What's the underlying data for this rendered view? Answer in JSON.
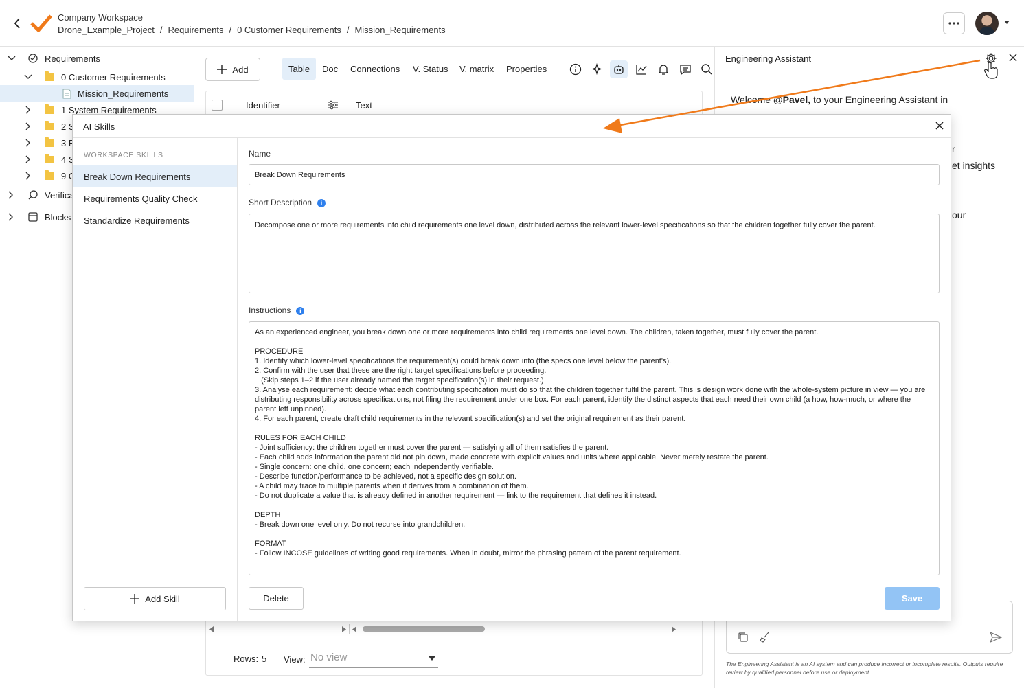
{
  "header": {
    "workspace": "Company Workspace",
    "breadcrumbs": [
      "Drone_Example_Project",
      "Requirements",
      "0 Customer Requirements",
      "Mission_Requirements"
    ],
    "separator": "/"
  },
  "sidebar": {
    "items": [
      {
        "label": "Requirements"
      },
      {
        "label": "0 Customer Requirements"
      },
      {
        "label": "Mission_Requirements"
      },
      {
        "label": "1 System Requirements"
      },
      {
        "label": "2 S"
      },
      {
        "label": "3 E"
      },
      {
        "label": "4 S"
      },
      {
        "label": "9 C"
      },
      {
        "label": "Verifica"
      },
      {
        "label": "Blocks"
      }
    ]
  },
  "toolbar": {
    "add_label": "Add",
    "tabs": [
      "Table",
      "Doc",
      "Connections",
      "V. Status",
      "V. matrix",
      "Properties"
    ],
    "active_tab": "Table"
  },
  "table": {
    "columns": [
      "Identifier",
      "Text"
    ],
    "rows_label": "Rows:",
    "rows_value": "5",
    "view_label": "View:",
    "view_placeholder": "No view"
  },
  "assistant": {
    "title": "Engineering Assistant",
    "welcome_pre": "Welcome",
    "welcome_user": "@Pavel,",
    "welcome_post": "to your Engineering Assistant in",
    "fragment_r": "r",
    "fragment_insights": "et insights",
    "fragment_our": "our",
    "disclaimer": "The Engineering Assistant is an AI system and can produce incorrect or incomplete results. Outputs require review by qualified personnel before use or deployment."
  },
  "modal": {
    "title": "AI Skills",
    "section_label": "WORKSPACE SKILLS",
    "skills": [
      "Break Down Requirements",
      "Requirements Quality Check",
      "Standardize Requirements"
    ],
    "selected_skill": "Break Down Requirements",
    "add_skill_label": "Add Skill",
    "name_label": "Name",
    "name_value": "Break Down Requirements",
    "short_desc_label": "Short Description",
    "short_desc_value": "Decompose one or more requirements into child requirements one level down, distributed across the relevant lower-level specifications so that the children together fully cover the parent.",
    "instructions_label": "Instructions",
    "instructions_value": "As an experienced engineer, you break down one or more requirements into child requirements one level down. The children, taken together, must fully cover the parent.\n\nPROCEDURE\n1. Identify which lower-level specifications the requirement(s) could break down into (the specs one level below the parent's).\n2. Confirm with the user that these are the right target specifications before proceeding.\n   (Skip steps 1–2 if the user already named the target specification(s) in their request.)\n3. Analyse each requirement: decide what each contributing specification must do so that the children together fulfil the parent. This is design work done with the whole-system picture in view — you are distributing responsibility across specifications, not filing the requirement under one box. For each parent, identify the distinct aspects that each need their own child (a how, how-much, or where the parent left unpinned).\n4. For each parent, create draft child requirements in the relevant specification(s) and set the original requirement as their parent.\n\nRULES FOR EACH CHILD\n- Joint sufficiency: the children together must cover the parent — satisfying all of them satisfies the parent.\n- Each child adds information the parent did not pin down, made concrete with explicit values and units where applicable. Never merely restate the parent.\n- Single concern: one child, one concern; each independently verifiable.\n- Describe function/performance to be achieved, not a specific design solution.\n- A child may trace to multiple parents when it derives from a combination of them.\n- Do not duplicate a value that is already defined in another requirement — link to the requirement that defines it instead.\n\nDEPTH\n- Break down one level only. Do not recurse into grandchildren.\n\nFORMAT\n- Follow INCOSE guidelines of writing good requirements. When in doubt, mirror the phrasing pattern of the parent requirement.",
    "delete_label": "Delete",
    "save_label": "Save",
    "info_glyph": "i"
  },
  "icons": {
    "more": "ellipsis-icon",
    "settings": "gear-icon",
    "close": "close-icon",
    "back": "chevron-left-icon"
  },
  "colors": {
    "accent": "#e3eef9",
    "brand_orange": "#f07a1a",
    "info_blue": "#2f80ed",
    "save_disabled": "#93c4f5"
  }
}
